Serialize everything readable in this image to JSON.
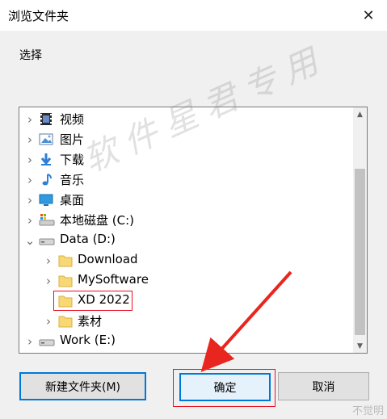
{
  "window": {
    "title": "浏览文件夹",
    "close_glyph": "✕"
  },
  "instruction": "选择",
  "tree": {
    "items": [
      {
        "label": "视频",
        "icon": "video-folder-icon",
        "indent": 0,
        "expander": "right",
        "selected": false
      },
      {
        "label": "图片",
        "icon": "pictures-folder-icon",
        "indent": 0,
        "expander": "right",
        "selected": false
      },
      {
        "label": "下载",
        "icon": "downloads-folder-icon",
        "indent": 0,
        "expander": "right",
        "selected": false
      },
      {
        "label": "音乐",
        "icon": "music-folder-icon",
        "indent": 0,
        "expander": "right",
        "selected": false
      },
      {
        "label": "桌面",
        "icon": "desktop-folder-icon",
        "indent": 0,
        "expander": "right",
        "selected": false
      },
      {
        "label": "本地磁盘 (C:)",
        "icon": "system-drive-icon",
        "indent": 0,
        "expander": "right",
        "selected": false
      },
      {
        "label": "Data (D:)",
        "icon": "drive-icon",
        "indent": 0,
        "expander": "down",
        "selected": false
      },
      {
        "label": "Download",
        "icon": "folder-icon",
        "indent": 1,
        "expander": "right",
        "selected": false
      },
      {
        "label": "MySoftware",
        "icon": "folder-icon",
        "indent": 1,
        "expander": "right",
        "selected": false
      },
      {
        "label": "XD 2022",
        "icon": "folder-icon",
        "indent": 1,
        "expander": "none",
        "selected": true
      },
      {
        "label": "素材",
        "icon": "folder-icon",
        "indent": 1,
        "expander": "right",
        "selected": false
      },
      {
        "label": "Work (E:)",
        "icon": "drive-icon",
        "indent": 0,
        "expander": "right",
        "selected": false
      }
    ]
  },
  "scrollbar": {
    "up_glyph": "▲",
    "down_glyph": "▼"
  },
  "buttons": {
    "new_folder": "新建文件夹(M)",
    "ok": "确定",
    "cancel": "取消"
  },
  "watermark": "软件星君专用",
  "corner_mark": "不觉明",
  "colors": {
    "accent": "#0078d7",
    "highlight_red": "#e81123",
    "arrow_red": "#e8261f",
    "folder_yellow": "#f8d775"
  }
}
